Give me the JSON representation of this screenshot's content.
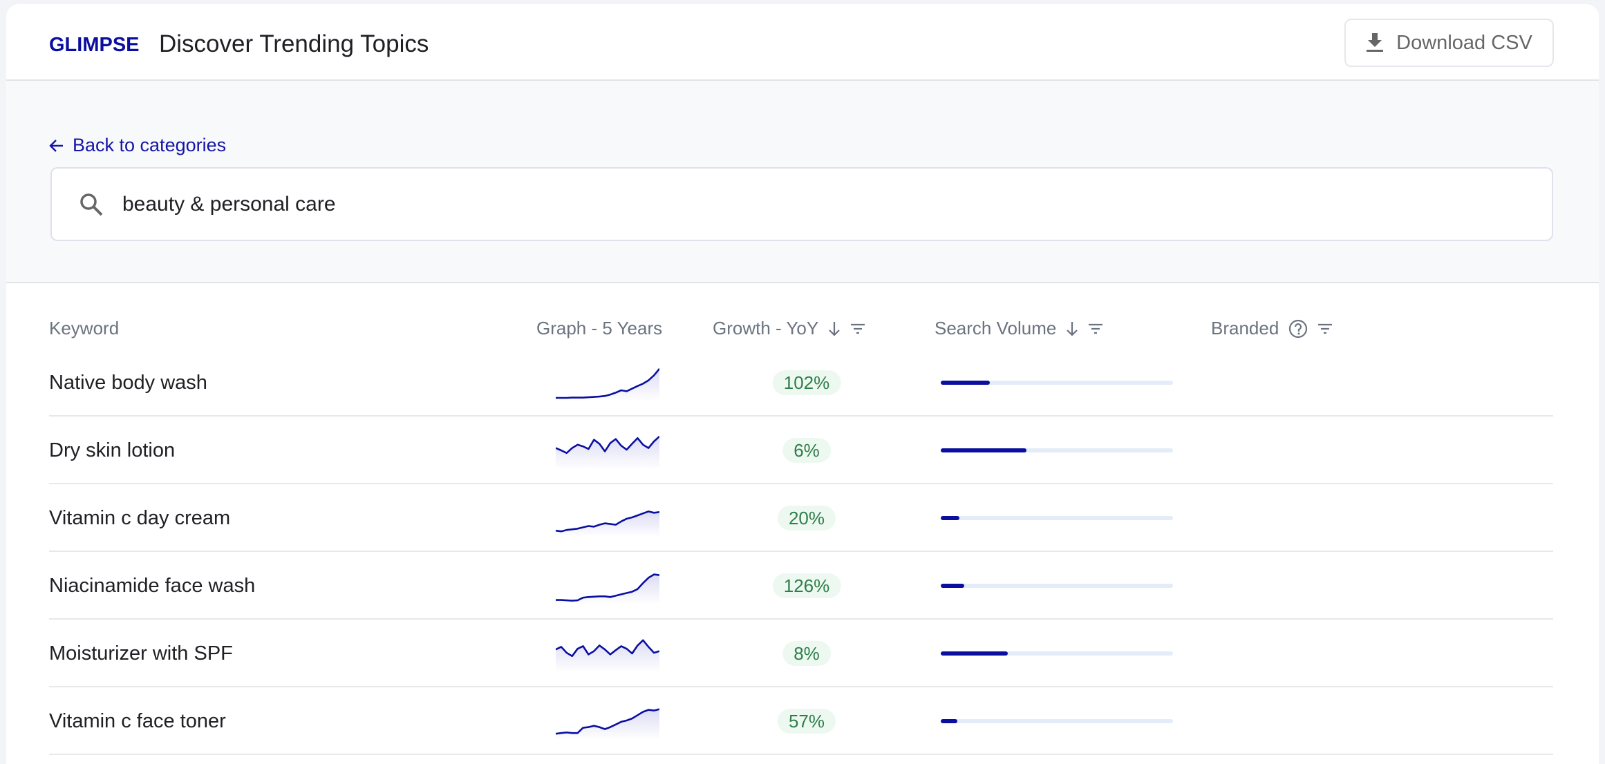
{
  "header": {
    "logo": "GLIMPSE",
    "title": "Discover Trending Topics",
    "download_label": "Download CSV"
  },
  "filters": {
    "back_label": "Back to categories",
    "search_value": "beauty & personal care"
  },
  "table": {
    "columns": [
      "Keyword",
      "Graph - 5 Years",
      "Growth - YoY",
      "Search Volume",
      "Branded"
    ],
    "accent": "#0b0fa0",
    "rows": [
      {
        "keyword": "Native body wash",
        "growth": "102%",
        "volume_fraction": 0.21,
        "trend": [
          2,
          2,
          2,
          3,
          3,
          3,
          4,
          5,
          6,
          8,
          12,
          18,
          25,
          22,
          30,
          38,
          45,
          55,
          70,
          90
        ]
      },
      {
        "keyword": "Dry skin lotion",
        "growth": "6%",
        "volume_fraction": 0.37,
        "trend": [
          55,
          48,
          40,
          55,
          65,
          60,
          52,
          80,
          68,
          45,
          70,
          82,
          62,
          50,
          68,
          85,
          65,
          55,
          75,
          90
        ]
      },
      {
        "keyword": "Vitamin c day cream",
        "growth": "20%",
        "volume_fraction": 0.08,
        "trend": [
          10,
          8,
          12,
          14,
          16,
          20,
          24,
          22,
          28,
          32,
          30,
          28,
          38,
          46,
          50,
          56,
          62,
          68,
          64,
          66
        ]
      },
      {
        "keyword": "Niacinamide face wash",
        "growth": "126%",
        "volume_fraction": 0.1,
        "trend": [
          5,
          5,
          4,
          3,
          4,
          12,
          14,
          15,
          16,
          16,
          14,
          18,
          22,
          26,
          30,
          38,
          56,
          72,
          82,
          80
        ]
      },
      {
        "keyword": "Moisturizer with SPF",
        "growth": "8%",
        "volume_fraction": 0.29,
        "trend": [
          60,
          68,
          50,
          40,
          62,
          70,
          45,
          55,
          72,
          60,
          45,
          58,
          70,
          62,
          48,
          72,
          88,
          68,
          50,
          55
        ]
      },
      {
        "keyword": "Vitamin c face toner",
        "growth": "57%",
        "volume_fraction": 0.07,
        "trend": [
          10,
          12,
          14,
          12,
          12,
          28,
          30,
          34,
          30,
          24,
          30,
          38,
          46,
          50,
          56,
          66,
          76,
          82,
          80,
          84
        ]
      }
    ]
  }
}
